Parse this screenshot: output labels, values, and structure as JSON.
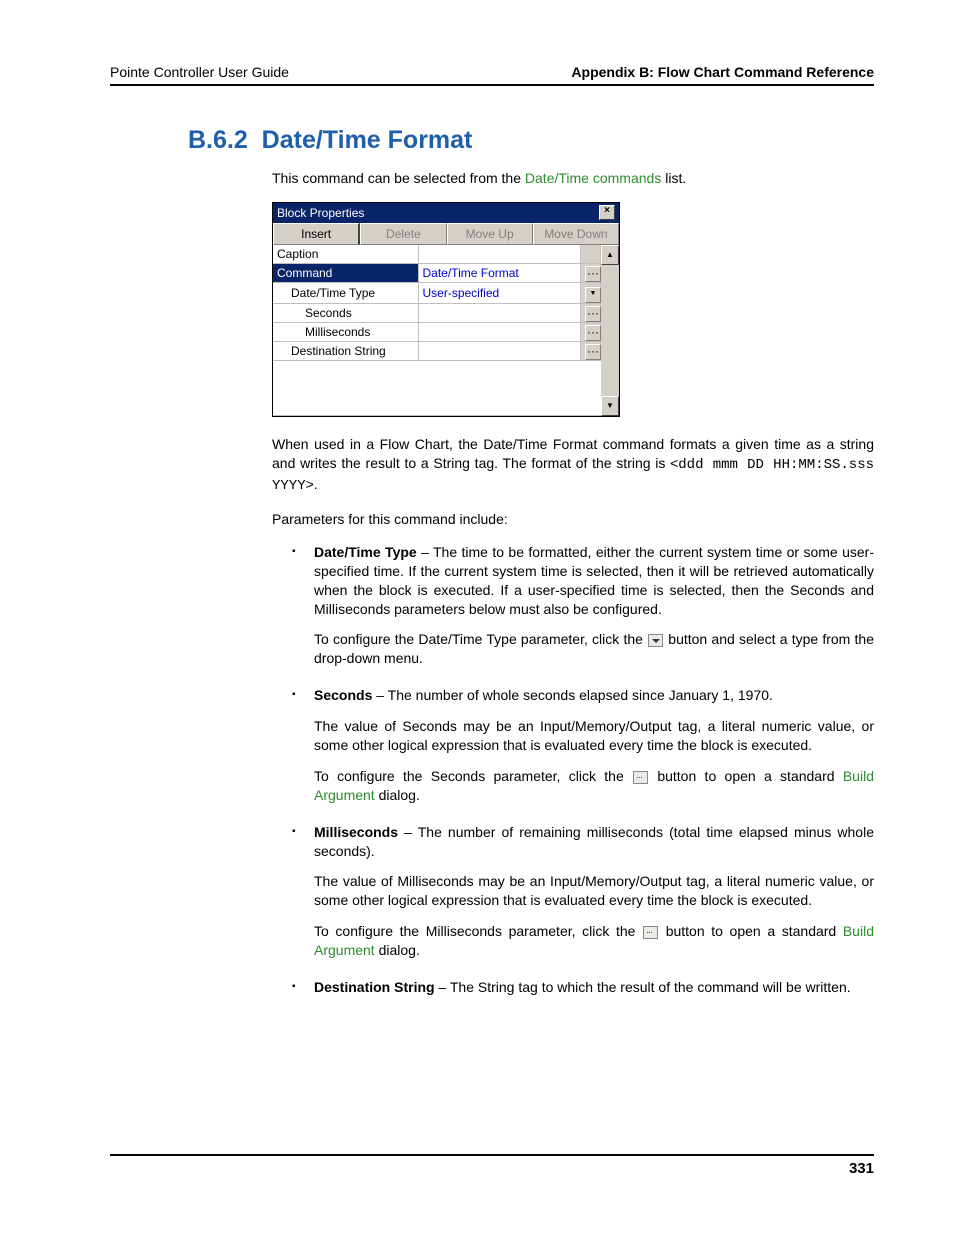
{
  "header": {
    "left": "Pointe Controller User Guide",
    "right": "Appendix B: Flow Chart Command Reference"
  },
  "section": {
    "number": "B.6.2",
    "title": "Date/Time Format"
  },
  "intro": {
    "pre": "This command can be selected from the ",
    "link": "Date/Time commands",
    "post": " list."
  },
  "dialog": {
    "title": "Block Properties",
    "close": "×",
    "tabs": {
      "insert": "Insert",
      "delete": "Delete",
      "moveup": "Move Up",
      "movedown": "Move Down"
    },
    "rows": {
      "caption_label": "Caption",
      "command_label": "Command",
      "command_value": "Date/Time Format",
      "dtt_label": "Date/Time Type",
      "dtt_value": "User-specified",
      "seconds_label": "Seconds",
      "ms_label": "Milliseconds",
      "dest_label": "Destination String"
    },
    "scroll_up": "▲",
    "scroll_down": "▼",
    "ellipsis": "···",
    "drop": "▼"
  },
  "desc": {
    "p1a": "When used in a Flow Chart, the Date/Time Format command formats a given time as a string and writes the result to a String tag. The format of the string is <",
    "p1code": "ddd mmm DD HH:MM:SS.sss YYYY",
    "p1b": ">.",
    "p2": "Parameters for this command include:"
  },
  "params": {
    "dtt": {
      "name": "Date/Time Type",
      "text": " – The time to be formatted, either the current system time or some user-specified time. If the current system time is selected, then it will be retrieved automatically when the block is executed. If a user-specified time is selected, then the Seconds and Milliseconds parameters below must also be configured.",
      "sub_a": "To configure the Date/Time Type parameter, click the ",
      "sub_b": " button and select a type from the drop-down menu."
    },
    "seconds": {
      "name": "Seconds",
      "text": " – The number of whole seconds elapsed since January 1, 1970.",
      "sub1": "The value of Seconds may be an Input/Memory/Output tag, a literal numeric value, or some other logical expression that is evaluated every time the block is executed.",
      "sub2_a": "To configure the Seconds parameter, click the ",
      "sub2_b": " button to open a standard ",
      "sub2_link": "Build Argument",
      "sub2_c": " dialog."
    },
    "ms": {
      "name": "Milliseconds",
      "text": " – The number of remaining milliseconds (total time elapsed minus whole seconds).",
      "sub1": "The value of Milliseconds may be an Input/Memory/Output tag, a literal numeric value, or some other logical expression that is evaluated every time the block is executed.",
      "sub2_a": "To configure the Milliseconds parameter, click the ",
      "sub2_b": " button to open a standard ",
      "sub2_link": "Build Argument",
      "sub2_c": " dialog."
    },
    "dest": {
      "name": "Destination String",
      "text": " – The String tag to which the result of the command will be written."
    }
  },
  "footer": {
    "page": "331"
  }
}
